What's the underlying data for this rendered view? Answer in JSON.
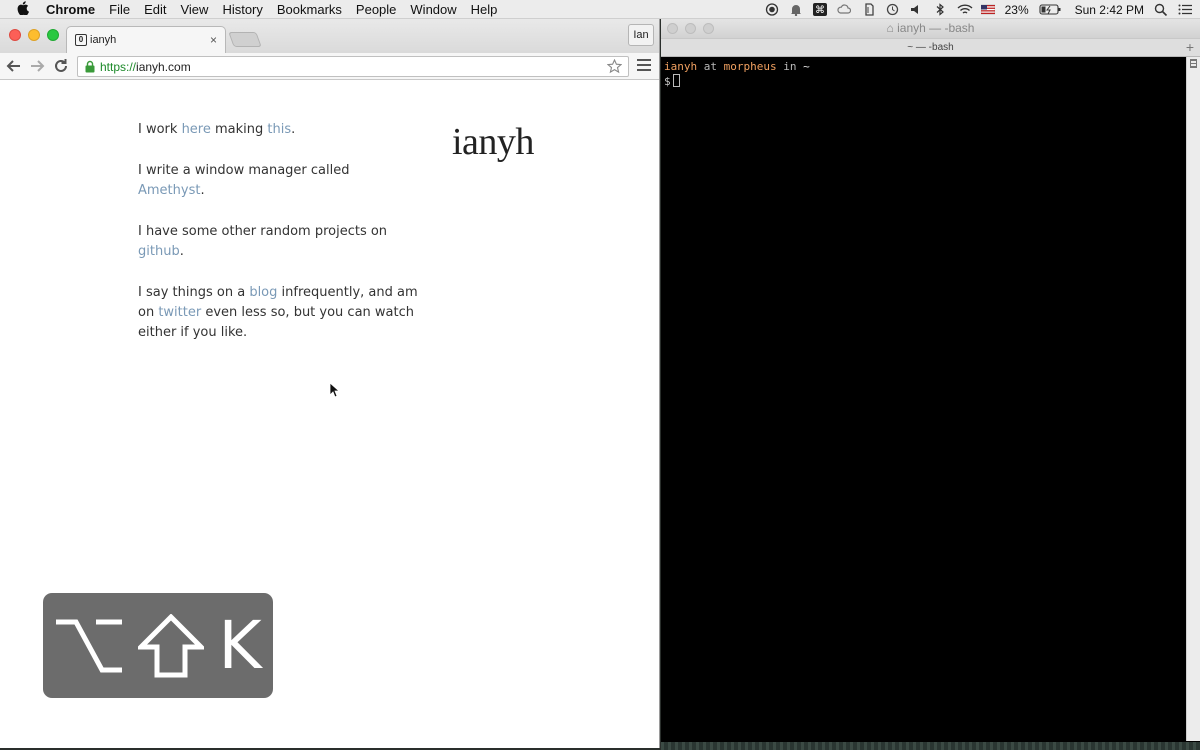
{
  "menubar": {
    "app_name": "Chrome",
    "menus": [
      "File",
      "Edit",
      "View",
      "History",
      "Bookmarks",
      "People",
      "Window",
      "Help"
    ],
    "battery": "23%",
    "clock": "Sun 2:42 PM",
    "icons": [
      "apple-icon",
      "record-icon",
      "notification-bell-icon",
      "command-icon",
      "cloud-icon",
      "evernote-icon",
      "time-machine-icon",
      "volume-icon",
      "bluetooth-icon",
      "wifi-icon",
      "us-flag-icon",
      "battery-icon",
      "spotlight-icon",
      "notification-center-icon"
    ]
  },
  "browser": {
    "tab_favicon": "0",
    "tab_title": "ianyh",
    "tab_close": "×",
    "profile": "Ian",
    "url_scheme": "https://",
    "url_host": "ianyh.com"
  },
  "page": {
    "logo": "ianyh",
    "p1": {
      "t1": "I work ",
      "link1": "here",
      "t2": " making ",
      "link2": "this",
      "t3": "."
    },
    "p2": {
      "t1": "I write a window manager called ",
      "link1": "Amethyst",
      "t2": "."
    },
    "p3": {
      "t1": "I have some other random projects on ",
      "link1": "github",
      "t2": "."
    },
    "p4": {
      "t1": "I say things on a ",
      "link1": "blog",
      "t2": " infrequently, and am on ",
      "link2": "twitter",
      "t3": " even less so, but you can watch either if you like."
    }
  },
  "key_overlay": {
    "keys": [
      "option-key-icon",
      "shift-key-icon"
    ],
    "letter": "K"
  },
  "terminal": {
    "title": "ianyh — -bash",
    "tab_title": "~ — -bash",
    "add_tab": "+",
    "prompt": {
      "user": "ianyh",
      "at": "at",
      "host": "morpheus",
      "in": "in",
      "cwd": "~",
      "symbol": "$"
    }
  }
}
